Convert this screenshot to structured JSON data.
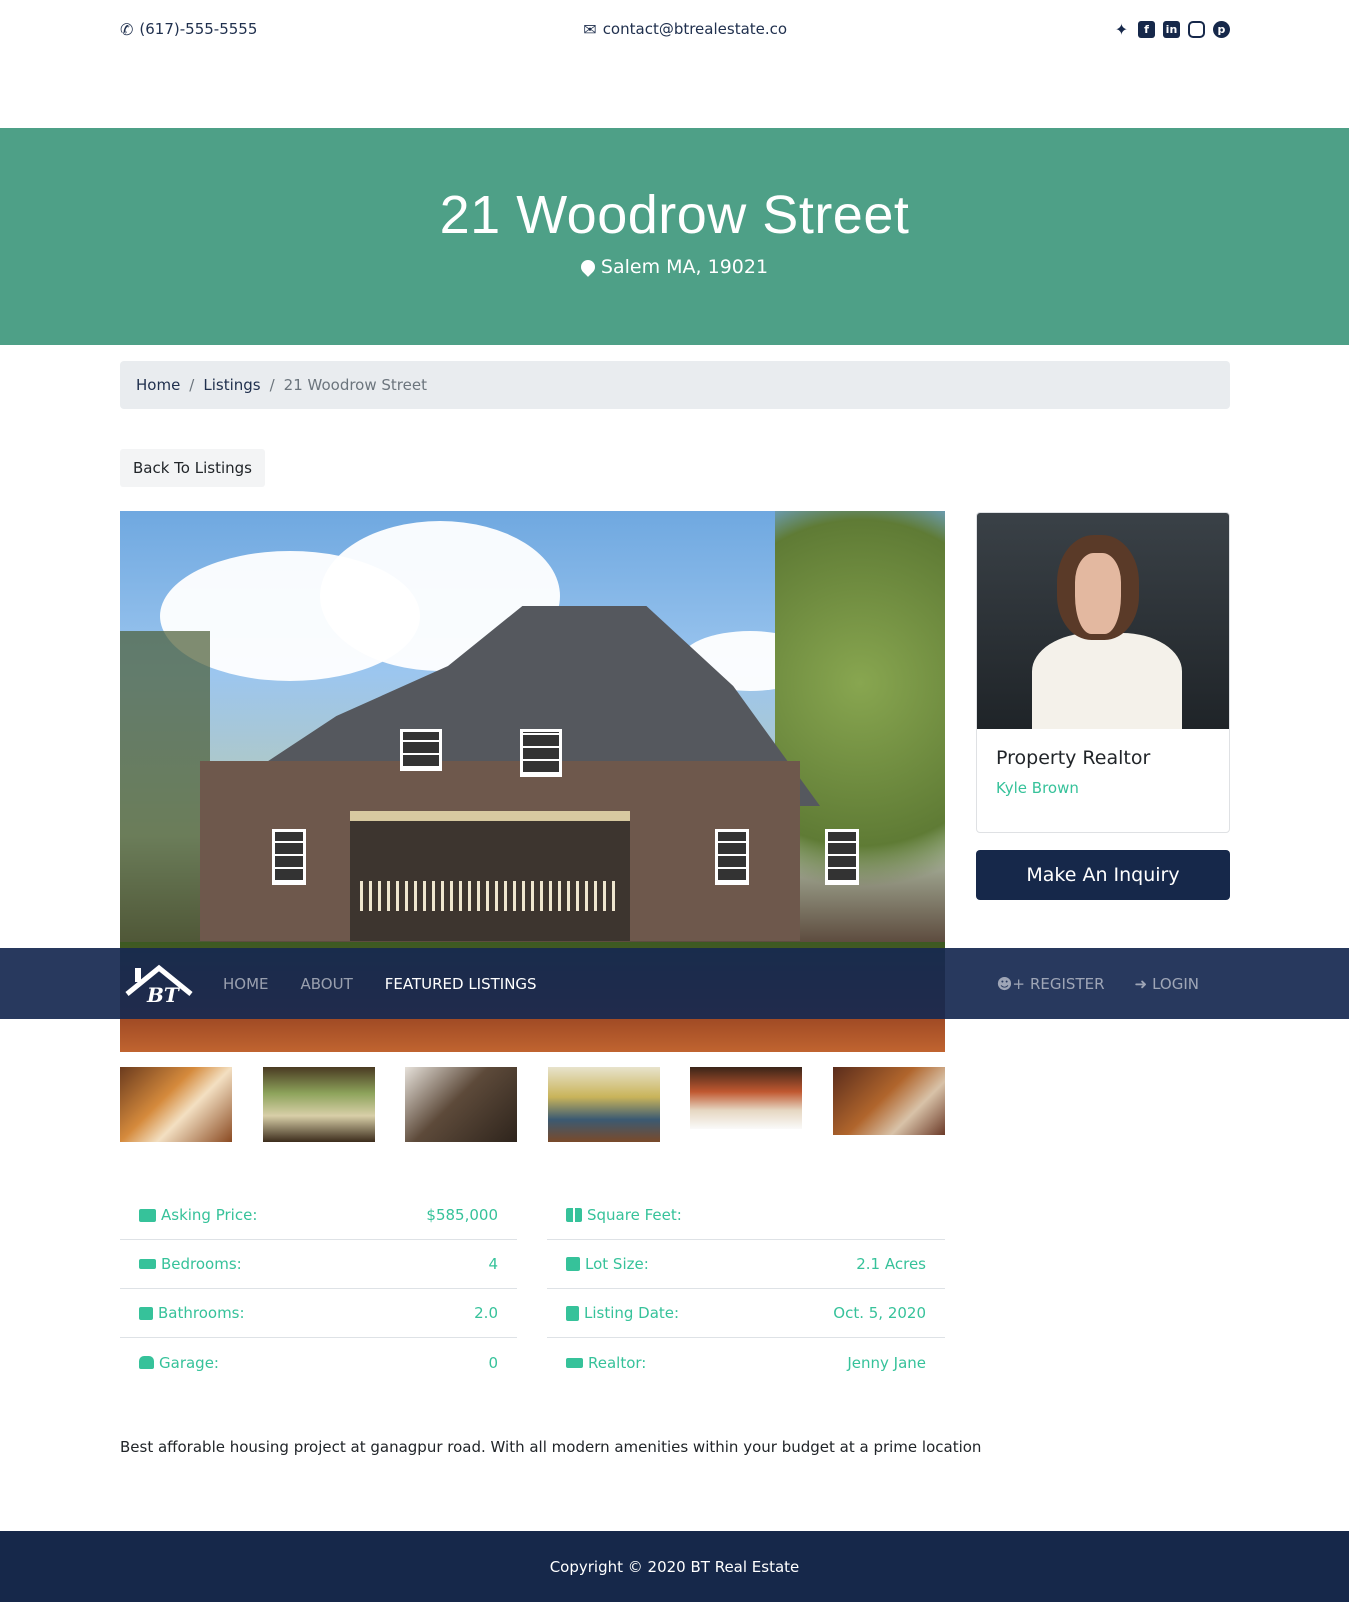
{
  "topbar": {
    "phone": "(617)-555-5555",
    "email": "contact@btrealestate.co",
    "social": [
      "twitter-icon",
      "facebook-icon",
      "linkedin-icon",
      "instagram-icon",
      "pinterest-icon"
    ]
  },
  "showcase": {
    "title": "21 Woodrow Street",
    "location": "Salem MA, 19021"
  },
  "breadcrumb": {
    "home": "Home",
    "listings": "Listings",
    "current": "21 Woodrow Street",
    "separator": "/"
  },
  "back_button": "Back To Listings",
  "navbar": {
    "logo_text": "BT",
    "links": [
      "HOME",
      "ABOUT",
      "FEATURED LISTINGS"
    ],
    "active": "FEATURED LISTINGS",
    "register": "REGISTER",
    "login": "LOGIN"
  },
  "realtor_card": {
    "title": "Property Realtor",
    "name": "Kyle Brown"
  },
  "inquiry_button": "Make An Inquiry",
  "details_left": [
    {
      "label": "Asking Price:",
      "value": "$585,000",
      "icon": "money-icon"
    },
    {
      "label": "Bedrooms:",
      "value": "4",
      "icon": "bed-icon"
    },
    {
      "label": "Bathrooms:",
      "value": "2.0",
      "icon": "bath-icon"
    },
    {
      "label": "Garage:",
      "value": "0",
      "icon": "car-icon"
    }
  ],
  "details_right": [
    {
      "label": "Square Feet:",
      "value": "",
      "icon": "th-large-icon"
    },
    {
      "label": "Lot Size:",
      "value": "2.1 Acres",
      "icon": "square-icon"
    },
    {
      "label": "Listing Date:",
      "value": "Oct. 5, 2020",
      "icon": "calendar-icon"
    },
    {
      "label": "Realtor:",
      "value": "Jenny Jane",
      "icon": "bed-icon"
    }
  ],
  "description": "Best afforable housing project at ganagpur road. With all modern amenities within your budget at a prime location",
  "footer": "Copyright © 2020 BT Real Estate",
  "colors": {
    "accent": "#36c29a",
    "showcase": "#4ea087",
    "navy": "#16284a"
  }
}
